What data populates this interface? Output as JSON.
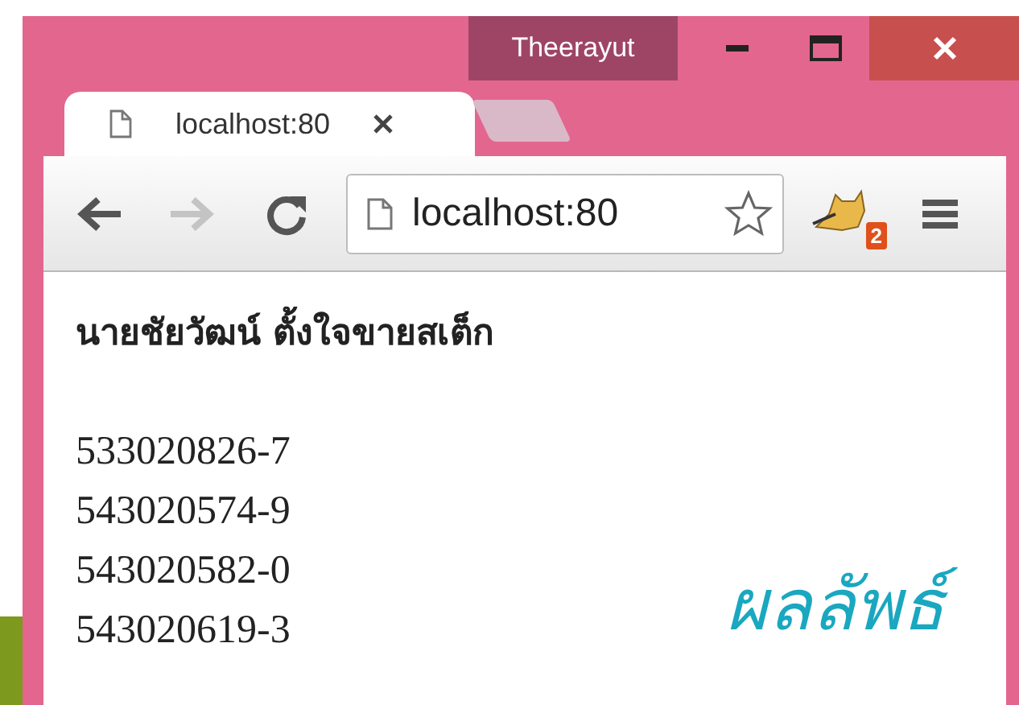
{
  "window": {
    "user": "Theerayut"
  },
  "tabs": [
    {
      "title": "localhost:80",
      "selected": true
    }
  ],
  "toolbar": {
    "address": "localhost:80",
    "extension_badge": "2"
  },
  "page": {
    "heading": "นายชัยวัฒน์ ตั้งใจขายสเต็ก",
    "lines": [
      "533020826-7",
      "543020574-9",
      "543020582-0",
      "543020619-3"
    ]
  },
  "caption": "ผลลัพธ์"
}
